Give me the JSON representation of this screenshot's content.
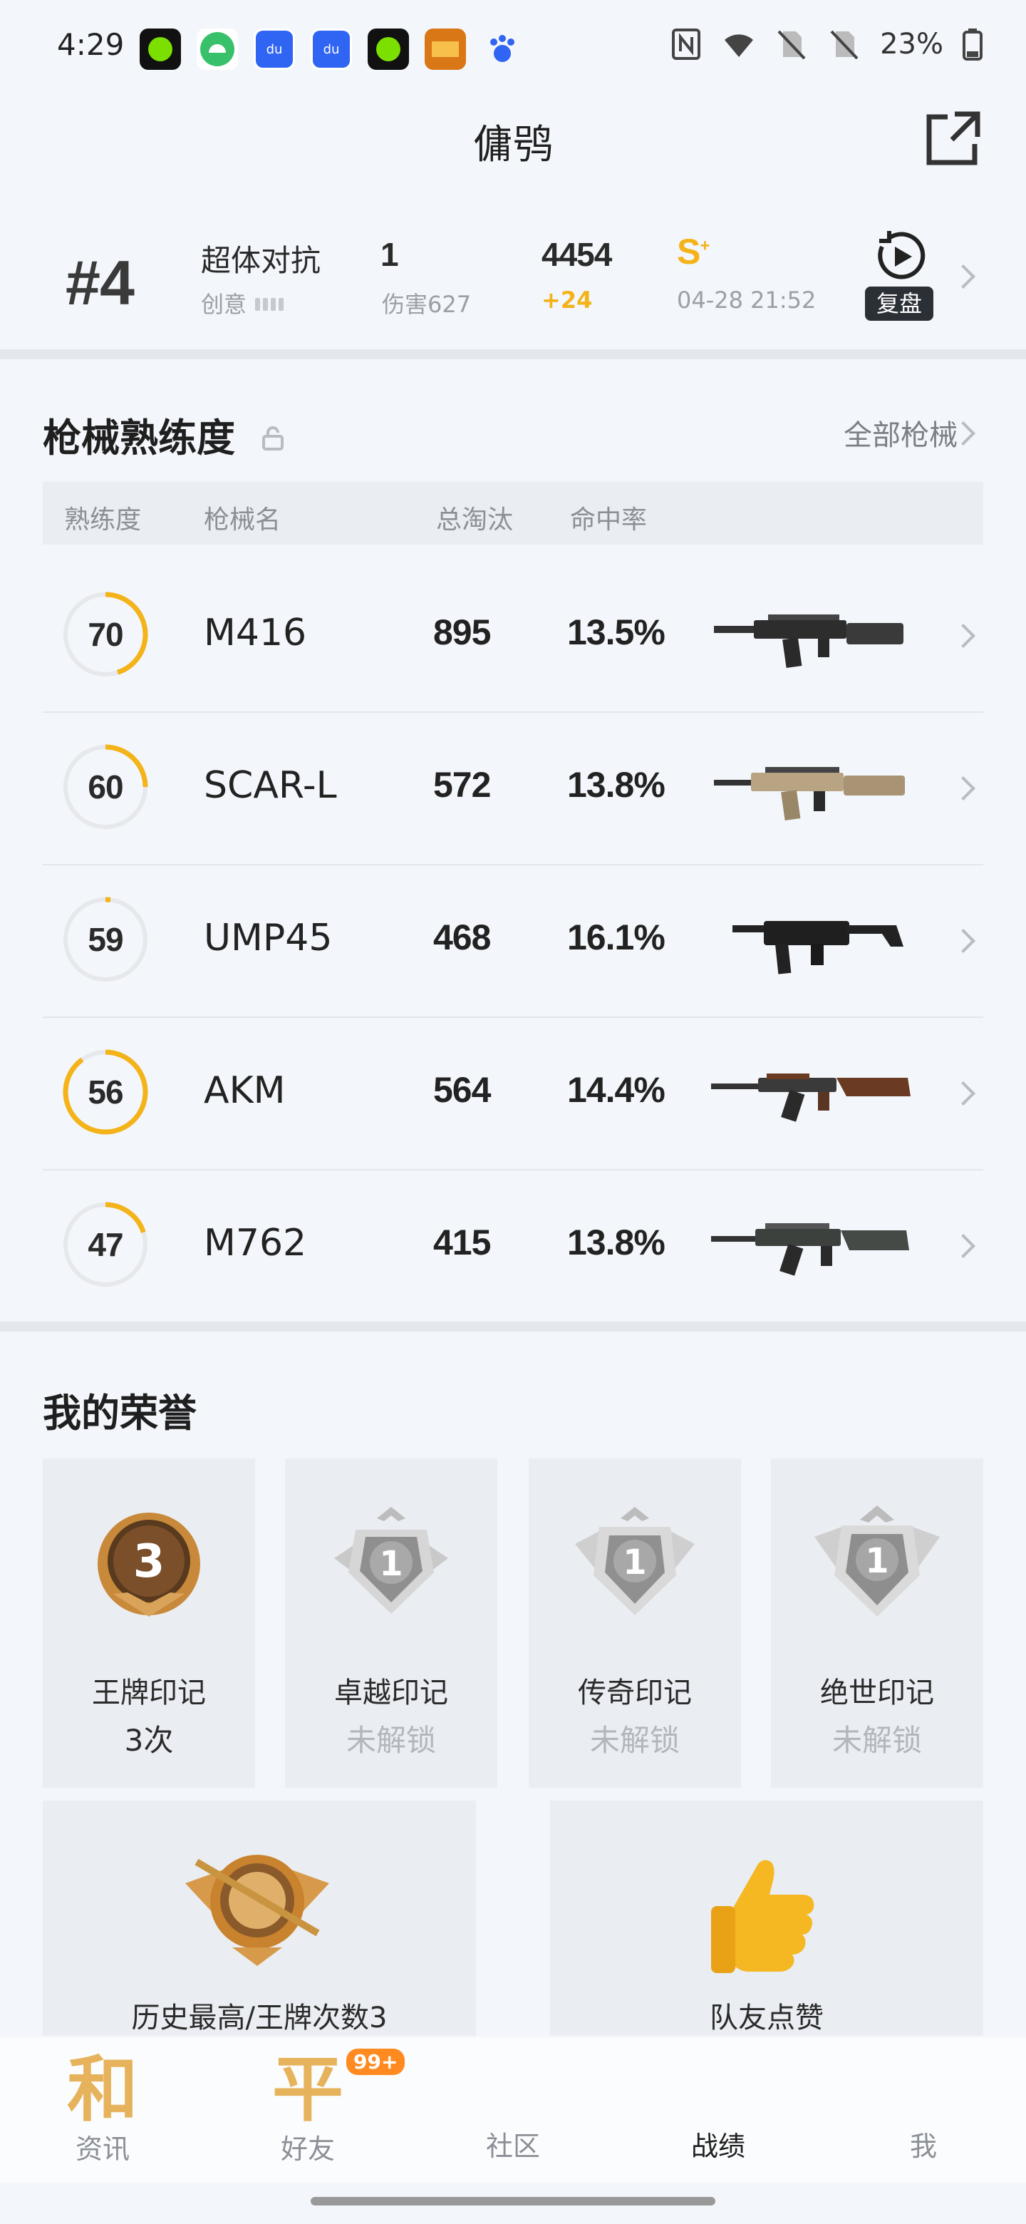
{
  "status_bar": {
    "time": "4:29",
    "battery": "23%",
    "app_icons": [
      "green-dot-app",
      "android-app",
      "baidu-ai-app",
      "baidu-ai-app",
      "green-dot-app",
      "game-app",
      "baidu-app"
    ]
  },
  "header": {
    "title": "傭鸮"
  },
  "match": {
    "rank": "#4",
    "mode": "超体对抗",
    "mode_sub": "创意",
    "kills": "1",
    "damage": "伤害627",
    "score": "4454",
    "score_delta": "+24",
    "tier": "S",
    "tier_sup": "+",
    "time": "04-28 21:52",
    "replay_label": "复盘"
  },
  "weapons": {
    "title": "枪械熟练度",
    "all_label": "全部枪械",
    "columns": [
      "熟练度",
      "枪械名",
      "总淘汰",
      "命中率"
    ],
    "rows": [
      {
        "proficiency": "70",
        "progress": 0.45,
        "name": "M416",
        "kills": "895",
        "accuracy": "13.5%"
      },
      {
        "proficiency": "60",
        "progress": 0.25,
        "name": "SCAR-L",
        "kills": "572",
        "accuracy": "13.8%"
      },
      {
        "proficiency": "59",
        "progress": 0.02,
        "name": "UMP45",
        "kills": "468",
        "accuracy": "16.1%"
      },
      {
        "proficiency": "56",
        "progress": 0.9,
        "name": "AKM",
        "kills": "564",
        "accuracy": "14.4%"
      },
      {
        "proficiency": "47",
        "progress": 0.2,
        "name": "M762",
        "kills": "415",
        "accuracy": "13.8%"
      }
    ]
  },
  "honors": {
    "title": "我的荣誉",
    "cards": [
      {
        "name": "王牌印记",
        "value": "3次",
        "locked": false,
        "badge_number": "3"
      },
      {
        "name": "卓越印记",
        "value": "未解锁",
        "locked": true,
        "badge_number": "1"
      },
      {
        "name": "传奇印记",
        "value": "未解锁",
        "locked": true,
        "badge_number": "1"
      },
      {
        "name": "绝世印记",
        "value": "未解锁",
        "locked": true,
        "badge_number": "1"
      }
    ],
    "wide": [
      {
        "label": "历史最高/王牌次数3"
      },
      {
        "label": "队友点赞"
      }
    ]
  },
  "nav": {
    "items": [
      {
        "label": "资讯",
        "icon_char": "和"
      },
      {
        "label": "好友",
        "icon_char": "平",
        "badge": "99+"
      },
      {
        "label": "社区"
      },
      {
        "label": "战绩",
        "active": true
      },
      {
        "label": "我"
      }
    ]
  },
  "colors": {
    "accent": "#f3b319",
    "ring_track": "#e6e8eb",
    "background": "#f3f6fa"
  }
}
